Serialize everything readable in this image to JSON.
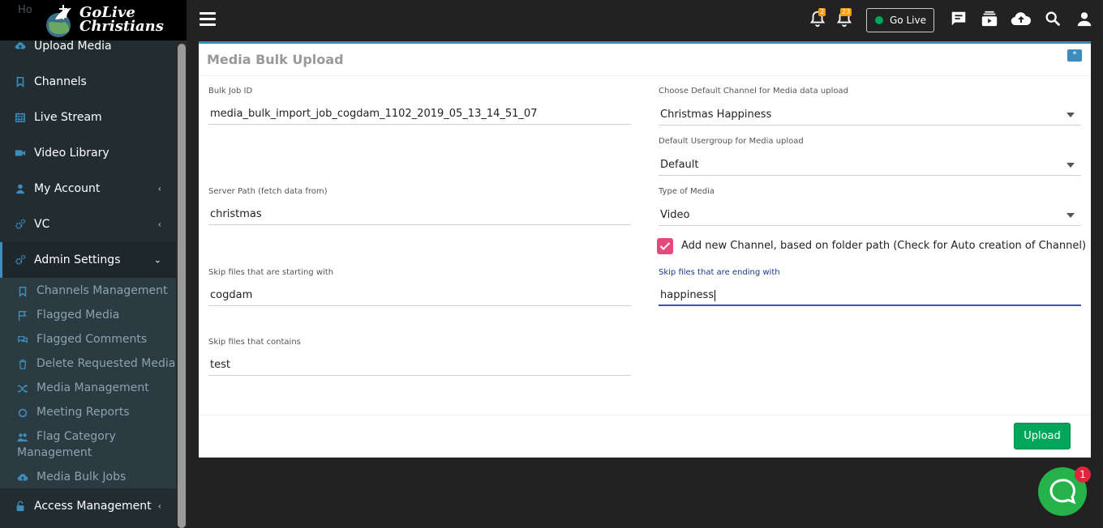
{
  "brand": {
    "logo_line1": "GoLive",
    "logo_line2": "Christians",
    "ghost_text": "Ho"
  },
  "sidebar": {
    "items": [
      {
        "label": "Upload Media",
        "icon": "cloud-upload-icon"
      },
      {
        "label": "Channels",
        "icon": "bookmark-icon"
      },
      {
        "label": "Live Stream",
        "icon": "calendar-icon"
      },
      {
        "label": "Video Library",
        "icon": "video-camera-icon"
      },
      {
        "label": "My Account",
        "icon": "user-icon",
        "chevron": "‹"
      },
      {
        "label": "VC",
        "icon": "cogs-icon",
        "chevron": "‹"
      },
      {
        "label": "Admin Settings",
        "icon": "cogs-icon",
        "chevron": "⌄"
      },
      {
        "label": "Access Management",
        "icon": "unlock-icon",
        "chevron": "‹"
      }
    ],
    "sub_items": [
      {
        "label": "Channels Management",
        "icon": "bookmark-icon"
      },
      {
        "label": "Flagged Media",
        "icon": "flag-icon"
      },
      {
        "label": "Flagged Comments",
        "icon": "comments-icon"
      },
      {
        "label": "Delete Requested Media",
        "icon": "trash-icon"
      },
      {
        "label": "Media Management",
        "icon": "random-icon"
      },
      {
        "label": "Meeting Reports",
        "icon": "circle-icon"
      },
      {
        "label": "Flag Category Management",
        "icon": "users-icon"
      },
      {
        "label": "Media Bulk Jobs",
        "icon": "cloud-upload-icon"
      }
    ]
  },
  "topbar": {
    "notifications_badge": "2",
    "alerts_badge": "23",
    "golive_label": "Go Live"
  },
  "form": {
    "title": "Media Bulk Upload",
    "tool_label": "*",
    "bulk_job_id": {
      "label": "Bulk Job ID",
      "value": "media_bulk_import_job_cogdam_1102_2019_05_13_14_51_07"
    },
    "default_channel": {
      "label": "Choose Default Channel for Media data upload",
      "value": "Christmas Happiness"
    },
    "default_usergroup": {
      "label": "Default Usergroup for Media upload",
      "value": "Default"
    },
    "server_path": {
      "label": "Server Path (fetch data from)",
      "value": "christmas"
    },
    "media_type": {
      "label": "Type of Media",
      "value": "Video"
    },
    "add_channel": {
      "label": "Add new Channel, based on folder path (Check for Auto creation of Channel)",
      "checked": true
    },
    "skip_start": {
      "label": "Skip files that are starting with",
      "value": "cogdam"
    },
    "skip_end": {
      "label": "Skip files that are ending with",
      "value": "happiness"
    },
    "skip_contains": {
      "label": "Skip files that contains",
      "value": "test"
    },
    "upload_label": "Upload"
  },
  "chat": {
    "badge": "1"
  },
  "colors": {
    "accent": "#3c8dbc",
    "success": "#00a65a",
    "checkbox": "#e5487f",
    "badge": "#f39c12"
  }
}
